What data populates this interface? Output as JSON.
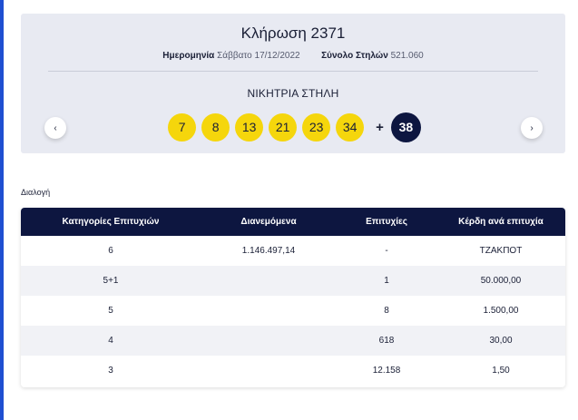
{
  "draw": {
    "title": "Κλήρωση 2371",
    "date_label": "Ημερομηνία",
    "date_value": "Σάββατο 17/12/2022",
    "columns_label": "Σύνολο Στηλών",
    "columns_value": "521.060",
    "winning_label": "ΝΙΚΗΤΡΙΑ ΣΤΗΛΗ",
    "numbers": [
      "7",
      "8",
      "13",
      "21",
      "23",
      "34"
    ],
    "plus": "+",
    "joker": "38",
    "prev_glyph": "‹",
    "next_glyph": "›",
    "ball_color": "#f5d60c",
    "joker_color": "#0d1640"
  },
  "section_label": "Διαλογή",
  "results": {
    "headers": [
      "Κατηγορίες Επιτυχιών",
      "Διανεμόμενα",
      "Επιτυχίες",
      "Κέρδη ανά επιτυχία"
    ],
    "rows": [
      [
        "6",
        "1.146.497,14",
        "-",
        "ΤΖΑΚΠΟΤ"
      ],
      [
        "5+1",
        "",
        "1",
        "50.000,00"
      ],
      [
        "5",
        "",
        "8",
        "1.500,00"
      ],
      [
        "4",
        "",
        "618",
        "30,00"
      ],
      [
        "3",
        "",
        "12.158",
        "1,50"
      ]
    ],
    "header_color": "#0d1640"
  }
}
